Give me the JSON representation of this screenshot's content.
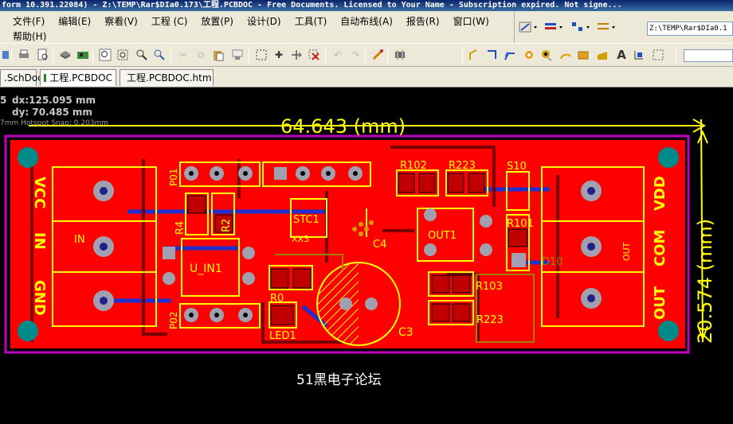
{
  "window": {
    "title": "form 10.391.22084) - Z:\\TEMP\\Rar$DIa0.173\\工程.PCBDOC - Free Documents. Licensed to Your Name - Subscription expired. Not signe..."
  },
  "menu": {
    "row1": [
      "文件(F)",
      "编辑(E)",
      "察看(V)",
      "工程 (C)",
      "放置(P)",
      "设计(D)",
      "工具(T)",
      "自动布线(A)",
      "报告(R)",
      "窗口(W)"
    ],
    "row2": [
      "帮助(H)"
    ]
  },
  "toolbar_right": {
    "path_value": "Z:\\TEMP\\Rar$DIa0.1"
  },
  "tabs": [
    {
      "label": ".SchDoc",
      "icon": "schematic-icon",
      "active": false
    },
    {
      "label": "工程.PCBDOC",
      "icon": "pcb-icon",
      "active": true
    },
    {
      "label": "工程.PCBDOC.htm",
      "icon": "web-page-icon",
      "active": false
    }
  ],
  "readout": {
    "dx": "dx:125.095  mm",
    "dy": "dy: 70.485   mm",
    "snap": "7mm Hotspot Snap: 0.203mm",
    "marker": "5"
  },
  "pcb": {
    "dim_horizontal": "64.643 (mm)",
    "dim_vertical": "20.574 (mm)",
    "left_labels": [
      "VCC",
      "IN",
      "GND"
    ],
    "right_labels": [
      "VDD",
      "COM",
      "OUT"
    ],
    "components": {
      "p01": "P01",
      "p02": "P02",
      "in": "IN",
      "r4": "R4",
      "r2": "R2",
      "u_in1": "U_IN1",
      "stc1": "STC1",
      "xx3": "XX3",
      "c4": "C4",
      "r102": "R102",
      "r223_top": "R223",
      "s10": "S10",
      "r101": "R101",
      "out1": "OUT1",
      "d10": "D10",
      "out_pad": "OUT",
      "r0": "R0",
      "led1": "LED1",
      "c3": "C3",
      "r103": "R103",
      "r223_bottom": "R223"
    },
    "colors": {
      "board": "#ff0000",
      "outline": "#c000c0",
      "silkscreen": "#ffff00",
      "via": "#008b8b",
      "bottom_trace": "#2030d0"
    }
  },
  "caption": "51黑电子论坛"
}
